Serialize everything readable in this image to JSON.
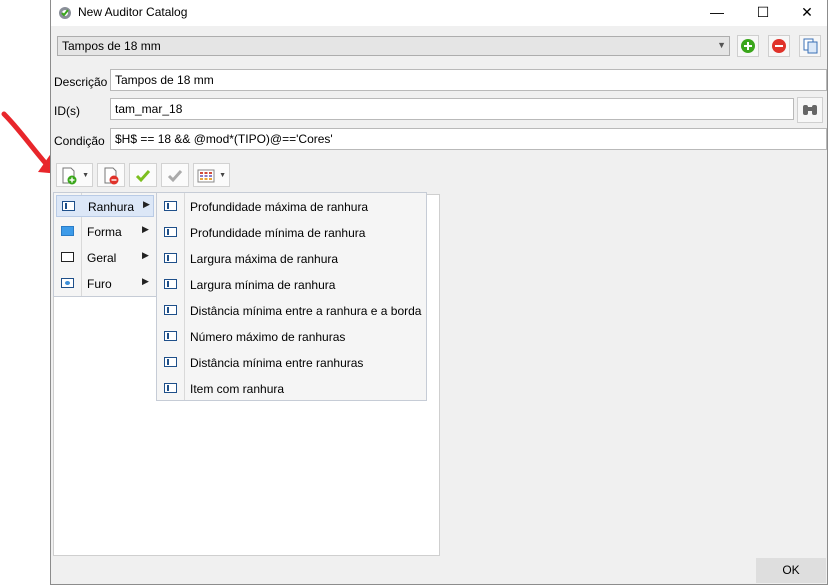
{
  "window": {
    "title": "New Auditor Catalog",
    "minimize_glyph": "—",
    "maximize_glyph": "☐",
    "close_glyph": "✕"
  },
  "catalog_select": {
    "value": "Tampos de 18 mm"
  },
  "form": {
    "descricao_label": "Descrição",
    "descricao_value": "Tampos de 18 mm",
    "ids_label": "ID(s)",
    "ids_value": "tam_mar_18",
    "condicao_label": "Condição",
    "condicao_value": "$H$ == 18 && @mod*(TIPO)@=='Cores'"
  },
  "context_menu": {
    "items": [
      {
        "label": "Ranhura",
        "icon": "ranhura-icon"
      },
      {
        "label": "Forma",
        "icon": "forma-icon"
      },
      {
        "label": "Geral",
        "icon": "geral-icon"
      },
      {
        "label": "Furo",
        "icon": "furo-icon"
      }
    ]
  },
  "submenu": {
    "items": [
      {
        "label": "Profundidade máxima de ranhura"
      },
      {
        "label": "Profundidade mínima de ranhura"
      },
      {
        "label": "Largura máxima de ranhura"
      },
      {
        "label": "Largura mínima de ranhura"
      },
      {
        "label": "Distância mínima entre a ranhura e a borda"
      },
      {
        "label": "Número máximo de ranhuras"
      },
      {
        "label": "Distância mínima entre ranhuras"
      },
      {
        "label": "Item com ranhura"
      }
    ]
  },
  "ok_label": "OK",
  "colors": {
    "annotation_arrow": "#e8262b",
    "add_green": "#3aa61b",
    "remove_red": "#e0322a",
    "menu_highlight": "#dce7f7"
  }
}
